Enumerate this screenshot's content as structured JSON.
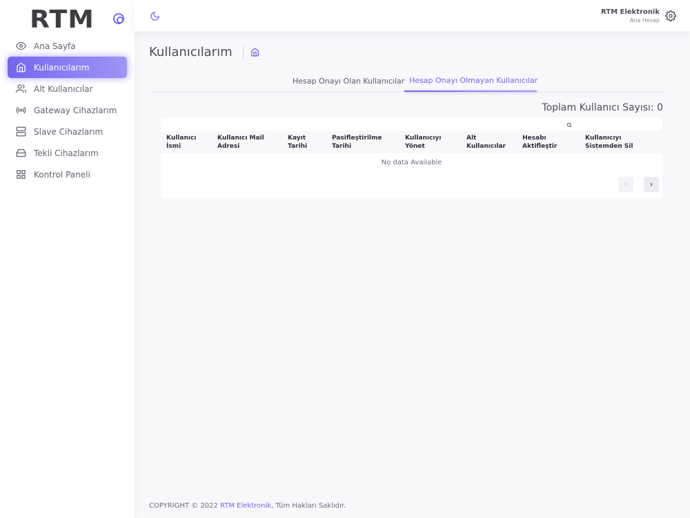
{
  "sidebar": {
    "brand": "RTM",
    "items": [
      {
        "label": "Ana Sayfa",
        "icon": "eye-icon"
      },
      {
        "label": "Kullanıcılarım",
        "icon": "home-icon",
        "active": true
      },
      {
        "label": "Alt Kullanıcılar",
        "icon": "users-icon"
      },
      {
        "label": "Gateway Cihazlarım",
        "icon": "broadcast-icon"
      },
      {
        "label": "Slave Cihazlarım",
        "icon": "server-icon"
      },
      {
        "label": "Tekli Cihazlarım",
        "icon": "hard-drive-icon"
      },
      {
        "label": "Kontrol Paneli",
        "icon": "grid-icon"
      }
    ]
  },
  "header": {
    "user_name": "RTM Elektronik",
    "user_role": "Ana Hesap"
  },
  "page": {
    "title": "Kullanıcılarım"
  },
  "tabs": [
    {
      "label": "Hesap Onayı Olan Kullanıcılar",
      "active": false
    },
    {
      "label": "Hesap Onayı Olmayan Kullanıcılar",
      "active": true
    }
  ],
  "table": {
    "total_label": "Toplam Kullanıcı Sayısı: 0",
    "search_placeholder": "",
    "columns": [
      "Kullanıcı İsmi",
      "Kullanıcı Mail Adresi",
      "Kayıt Tarihi",
      "Pasifleştirilme Tarihi",
      "Kullanıcıyı Yönet",
      "Alt Kullanıcılar",
      "Hesabı Aktifleştir",
      "Kullanıcıyı Sistemden Sil"
    ],
    "empty_text": "No data Available"
  },
  "footer": {
    "prefix": "COPYRIGHT © 2022 ",
    "brand": "RTM Elektronik",
    "suffix": ", Tüm Hakları Saklıdır."
  },
  "colors": {
    "accent": "#7367f0",
    "background": "#f8f7fa"
  }
}
